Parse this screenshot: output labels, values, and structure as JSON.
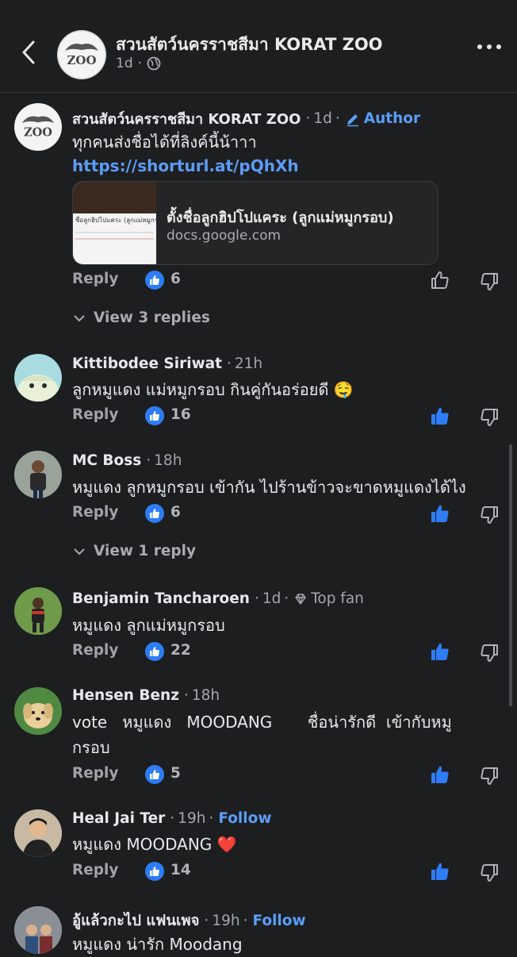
{
  "header": {
    "page_name": "สวนสัตว์นครราชสีมา KORAT ZOO",
    "time": "1d",
    "back_icon": "chevron-left-icon",
    "more_icon": "more-horizontal-icon"
  },
  "comments": [
    {
      "author": "สวนสัตว์นครราชสีมา KORAT ZOO",
      "time": "1d",
      "badge": "Author",
      "text": "ทุกคนส่งชื่อได้ที่ลิงค์นี้น้าาา",
      "link": "https://shorturl.at/pQhXh",
      "preview": {
        "title": "ตั้งชื่อลูกฮิปโปแคระ (ลูกแม่หมูกรอบ)",
        "domain": "docs.google.com",
        "thumb_caption": "ชื่อลูกฮิปโปแคระ (ลูกแม่หมูกรอบ)"
      },
      "reply_label": "Reply",
      "likes": "6",
      "liked": false,
      "view_replies": "View 3 replies"
    },
    {
      "author": "Kittibodee Siriwat",
      "time": "21h",
      "text": "ลูกหมูแดง แม่หมูกรอบ กินคู่กันอร่อยดี 🤤",
      "reply_label": "Reply",
      "likes": "16",
      "liked": true
    },
    {
      "author": "MC Boss",
      "time": "18h",
      "text": "หมูแดง ลูกหมูกรอบ เข้ากัน ไปร้านข้าวจะขาดหมูแดงได้ไง",
      "reply_label": "Reply",
      "likes": "6",
      "liked": true,
      "view_replies": "View 1 reply"
    },
    {
      "author": "Benjamin Tancharoen",
      "time": "1d",
      "badge": "Top fan",
      "text": "หมูแดง ลูกแม่หมูกรอบ",
      "reply_label": "Reply",
      "likes": "22",
      "liked": true
    },
    {
      "author": "Hensen Benz",
      "time": "18h",
      "text_line1": "vote   หมูแดง   MOODANG       ชื่อน่ารักดี  เข้ากับหมู",
      "text_line2": "กรอบ",
      "reply_label": "Reply",
      "likes": "5",
      "liked": true
    },
    {
      "author": "Heal Jai Ter",
      "time": "19h",
      "follow": "Follow",
      "text": "หมูแดง MOODANG ❤️",
      "reply_label": "Reply",
      "likes": "14",
      "liked": true
    },
    {
      "author": "อู้แล้วกะไป แฟนเพจ",
      "time": "19h",
      "follow": "Follow",
      "text": "หมูแดง น่ารัก Moodang"
    }
  ],
  "colors": {
    "background": "#1d1e20",
    "accent": "#2e7cf6",
    "link": "#5c9cf7"
  }
}
